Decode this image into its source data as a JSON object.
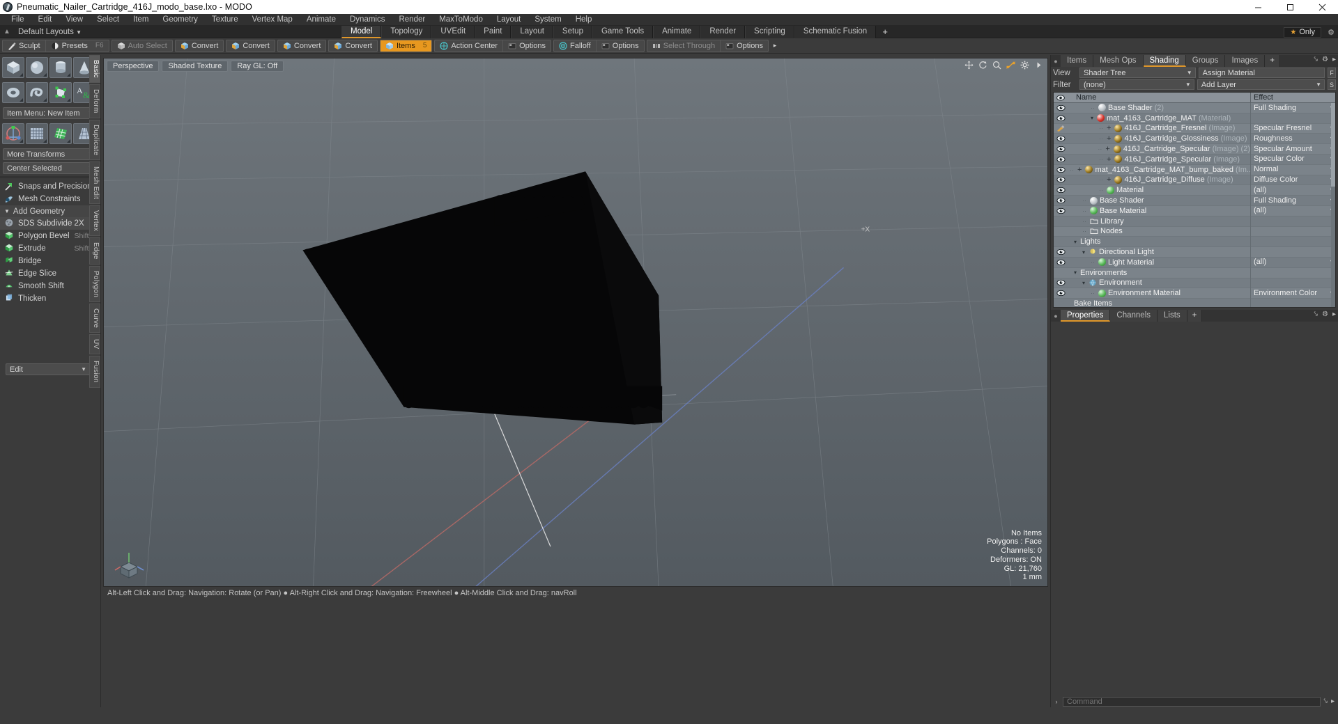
{
  "window": {
    "title": "Pneumatic_Nailer_Cartridge_416J_modo_base.lxo - MODO",
    "minimize": "—",
    "maximize": "☐",
    "close": "✕"
  },
  "menubar": {
    "items": [
      "File",
      "Edit",
      "View",
      "Select",
      "Item",
      "Geometry",
      "Texture",
      "Vertex Map",
      "Animate",
      "Dynamics",
      "Render",
      "MaxToModo",
      "Layout",
      "System",
      "Help"
    ]
  },
  "layoutbar": {
    "default_layouts": "Default Layouts",
    "tabs": [
      {
        "label": "Model",
        "active": true
      },
      {
        "label": "Topology",
        "active": false
      },
      {
        "label": "UVEdit",
        "active": false
      },
      {
        "label": "Paint",
        "active": false
      },
      {
        "label": "Layout",
        "active": false
      },
      {
        "label": "Setup",
        "active": false
      },
      {
        "label": "Game Tools",
        "active": false
      },
      {
        "label": "Animate",
        "active": false
      },
      {
        "label": "Render",
        "active": false
      },
      {
        "label": "Scripting",
        "active": false
      },
      {
        "label": "Schematic Fusion",
        "active": false
      }
    ],
    "add_tab": "+",
    "only_label": "Only",
    "star": "★"
  },
  "toolbar": {
    "groups": [
      {
        "buttons": [
          {
            "label": "Sculpt",
            "icon": "sculpt-icon",
            "shortcut": "",
            "active": false,
            "dim": false
          },
          {
            "label": "Presets",
            "icon": "presets-icon",
            "shortcut": "F6",
            "active": false,
            "dim": false
          }
        ]
      },
      {
        "buttons": [
          {
            "label": "Auto Select",
            "icon": "cube-grey-icon",
            "shortcut": "",
            "active": false,
            "dim": true
          }
        ]
      },
      {
        "buttons": [
          {
            "label": "Convert",
            "icon": "convert-icon",
            "shortcut": "",
            "active": false,
            "dim": false
          }
        ]
      },
      {
        "buttons": [
          {
            "label": "Convert",
            "icon": "convert-icon",
            "shortcut": "",
            "active": false,
            "dim": false
          }
        ]
      },
      {
        "buttons": [
          {
            "label": "Convert",
            "icon": "convert-icon",
            "shortcut": "",
            "active": false,
            "dim": false
          }
        ]
      },
      {
        "buttons": [
          {
            "label": "Convert",
            "icon": "convert-icon",
            "shortcut": "",
            "active": false,
            "dim": false
          }
        ]
      },
      {
        "buttons": [
          {
            "label": "Items",
            "icon": "items-cube-icon",
            "shortcut": "5",
            "active": true,
            "dim": false
          }
        ]
      },
      {
        "buttons": [
          {
            "label": "Action Center",
            "icon": "action-center-icon",
            "shortcut": "",
            "active": false,
            "dim": false
          },
          {
            "label": "Options",
            "icon": "options-icon",
            "shortcut": "",
            "active": false,
            "dim": false
          }
        ]
      },
      {
        "buttons": [
          {
            "label": "Falloff",
            "icon": "falloff-icon",
            "shortcut": "",
            "active": false,
            "dim": false
          },
          {
            "label": "Options",
            "icon": "options-icon",
            "shortcut": "",
            "active": false,
            "dim": false
          }
        ]
      },
      {
        "buttons": [
          {
            "label": "Select Through",
            "icon": "select-through-icon",
            "shortcut": "",
            "active": false,
            "dim": true
          },
          {
            "label": "Options",
            "icon": "options-icon",
            "shortcut": "",
            "active": false,
            "dim": false
          }
        ]
      }
    ],
    "overflow_arrow": "▸"
  },
  "left_toolbox": {
    "primitives_row1": [
      "cube-icon",
      "sphere-icon",
      "cylinder-icon",
      "cone-icon"
    ],
    "primitives_row2": [
      "torus-icon",
      "spiral-icon",
      "polygon-pen-icon",
      "text-icon"
    ],
    "item_menu": "Item Menu: New Item",
    "transform_row": [
      "transform-gizmo-icon",
      "bend-grid-icon",
      "shear-icon",
      "taper-icon"
    ],
    "more_transforms": "More Transforms",
    "center_selected": "Center Selected",
    "snaps": "Snaps and Precision",
    "mesh_constraints": "Mesh Constraints",
    "add_geometry_section": "Add Geometry",
    "geometry_items": [
      {
        "label": "SDS Subdivide 2X",
        "shortcut": "",
        "highlight": true,
        "icon": "sds-icon"
      },
      {
        "label": "Polygon Bevel",
        "shortcut": "Shift-B",
        "highlight": false,
        "icon": "bevel-icon"
      },
      {
        "label": "Extrude",
        "shortcut": "Shift-X",
        "highlight": false,
        "icon": "extrude-icon"
      },
      {
        "label": "Bridge",
        "shortcut": "",
        "highlight": false,
        "icon": "bridge-icon"
      },
      {
        "label": "Edge Slice",
        "shortcut": "",
        "highlight": false,
        "icon": "edge-slice-icon"
      },
      {
        "label": "Smooth Shift",
        "shortcut": "",
        "highlight": false,
        "icon": "smooth-shift-icon"
      },
      {
        "label": "Thicken",
        "shortcut": "",
        "highlight": false,
        "icon": "thicken-icon"
      }
    ],
    "edit_combo": "Edit",
    "mode_tabs": [
      {
        "label": "Basic",
        "active": true
      },
      {
        "label": "Deform",
        "active": false
      },
      {
        "label": "Duplicate",
        "active": false
      },
      {
        "label": "Mesh Edit",
        "active": false
      },
      {
        "label": "Vertex",
        "active": false
      },
      {
        "label": "Edge",
        "active": false
      },
      {
        "label": "Polygon",
        "active": false
      },
      {
        "label": "Curve",
        "active": false
      },
      {
        "label": "UV",
        "active": false
      },
      {
        "label": "Fusion",
        "active": false
      }
    ]
  },
  "viewport": {
    "tabs": [
      "Perspective",
      "Shaded Texture",
      "Ray GL: Off"
    ],
    "icons": [
      "move-icon",
      "rotate-icon",
      "zoom-icon",
      "fit-icon",
      "gear-icon",
      "chevron-right-icon"
    ],
    "axis_label_x": "+X",
    "stats": [
      "No Items",
      "Polygons : Face",
      "Channels: 0",
      "Deformers: ON",
      "GL: 21,760",
      "1 mm"
    ],
    "status": "Alt-Left Click and Drag: Navigation: Rotate (or Pan) ●  Alt-Right Click and Drag: Navigation: Freewheel ●  Alt-Middle Click and Drag: navRoll"
  },
  "right_panel": {
    "tabs": [
      {
        "label": "Items",
        "active": false
      },
      {
        "label": "Mesh Ops",
        "active": false
      },
      {
        "label": "Shading",
        "active": true
      },
      {
        "label": "Groups",
        "active": false
      },
      {
        "label": "Images",
        "active": false
      },
      {
        "label": "+",
        "active": false
      }
    ],
    "view_label": "View",
    "view_value": "Shader Tree",
    "assign_material": "Assign Material",
    "assign_material_btn": "F",
    "filter_label": "Filter",
    "filter_value": "(none)",
    "add_layer": "Add Layer",
    "add_layer_btn": "S",
    "columns": {
      "name": "Name",
      "effect": "Effect"
    },
    "tree": [
      {
        "indent": 2,
        "name": "Base Shader",
        "sub": "(2)",
        "effect": "Full Shading",
        "icon": "shader-sphere-white",
        "eye": "eye",
        "has_caret": true,
        "plus": false
      },
      {
        "indent": 2,
        "name": "mat_4163_Cartridge_MAT",
        "sub": "(Material)",
        "effect": "",
        "icon": "material-sphere-red",
        "eye": "eye",
        "has_caret": false,
        "expander": "down",
        "plus": false
      },
      {
        "indent": 3,
        "name": "416J_Cartridge_Fresnel",
        "sub": "(Image)",
        "effect": "Specular Fresnel",
        "icon": "image-sphere-gold",
        "eye": "brush",
        "has_caret": true,
        "plus": true
      },
      {
        "indent": 3,
        "name": "416J_Cartridge_Glossiness",
        "sub": "(Image)",
        "effect": "Roughness",
        "icon": "image-sphere-gold",
        "eye": "eye",
        "has_caret": true,
        "plus": true
      },
      {
        "indent": 3,
        "name": "416J_Cartridge_Specular",
        "sub": "(Image) (2)",
        "effect": "Specular Amount",
        "icon": "image-sphere-gold",
        "eye": "eye",
        "has_caret": true,
        "plus": true
      },
      {
        "indent": 3,
        "name": "416J_Cartridge_Specular",
        "sub": "(Image)",
        "effect": "Specular Color",
        "icon": "image-sphere-gold",
        "eye": "eye",
        "has_caret": true,
        "plus": true
      },
      {
        "indent": 3,
        "name": "mat_4163_Cartridge_MAT_bump_baked",
        "sub": "(Im...",
        "effect": "Normal",
        "icon": "image-sphere-gold",
        "eye": "eye",
        "has_caret": true,
        "plus": true
      },
      {
        "indent": 3,
        "name": "416J_Cartridge_Diffuse",
        "sub": "(Image)",
        "effect": "Diffuse Color",
        "icon": "image-sphere-gold",
        "eye": "eye",
        "has_caret": true,
        "plus": true
      },
      {
        "indent": 3,
        "name": "Material",
        "sub": "",
        "effect": "(all)",
        "icon": "material-sphere-green",
        "eye": "eye",
        "has_caret": true,
        "plus": false
      },
      {
        "indent": 1,
        "name": "Base Shader",
        "sub": "",
        "effect": "Full Shading",
        "icon": "shader-sphere-white",
        "eye": "eye",
        "has_caret": true,
        "plus": false
      },
      {
        "indent": 1,
        "name": "Base Material",
        "sub": "",
        "effect": "(all)",
        "icon": "material-sphere-green",
        "eye": "eye",
        "has_caret": true,
        "plus": false
      },
      {
        "indent": 1,
        "name": "Library",
        "sub": "",
        "effect": "",
        "icon": "folder-icon",
        "eye": "",
        "has_caret": false,
        "plus": false
      },
      {
        "indent": 1,
        "name": "Nodes",
        "sub": "",
        "effect": "",
        "icon": "folder-icon",
        "eye": "",
        "has_caret": false,
        "plus": false
      },
      {
        "indent": 0,
        "name": "Lights",
        "sub": "",
        "effect": "",
        "icon": "",
        "eye": "",
        "has_caret": false,
        "expander": "down",
        "plus": false
      },
      {
        "indent": 1,
        "name": "Directional Light",
        "sub": "",
        "effect": "",
        "icon": "light-icon",
        "eye": "eye",
        "has_caret": false,
        "expander": "down",
        "plus": false
      },
      {
        "indent": 2,
        "name": "Light Material",
        "sub": "",
        "effect": "(all)",
        "icon": "material-sphere-green",
        "eye": "eye",
        "has_caret": true,
        "plus": false
      },
      {
        "indent": 0,
        "name": "Environments",
        "sub": "",
        "effect": "",
        "icon": "",
        "eye": "",
        "has_caret": false,
        "expander": "down",
        "plus": false
      },
      {
        "indent": 1,
        "name": "Environment",
        "sub": "",
        "effect": "",
        "icon": "env-icon",
        "eye": "eye",
        "has_caret": false,
        "expander": "down",
        "plus": false
      },
      {
        "indent": 2,
        "name": "Environment Material",
        "sub": "",
        "effect": "Environment Color",
        "icon": "material-sphere-green",
        "eye": "eye",
        "has_caret": true,
        "plus": false
      },
      {
        "indent": 0,
        "name": "Bake Items",
        "sub": "",
        "effect": "",
        "icon": "",
        "eye": "",
        "has_caret": false,
        "plus": false
      }
    ],
    "properties_tabs": [
      {
        "label": "Properties",
        "active": true
      },
      {
        "label": "Channels",
        "active": false
      },
      {
        "label": "Lists",
        "active": false
      },
      {
        "label": "+",
        "active": false
      }
    ]
  },
  "command_bar": {
    "chevron": "›",
    "placeholder": "Command"
  },
  "colors": {
    "accent_orange": "#e8981f",
    "panel_bg": "#3b3b3b",
    "tree_bg": "#7b838a",
    "viewport_top": "#6f767c"
  }
}
